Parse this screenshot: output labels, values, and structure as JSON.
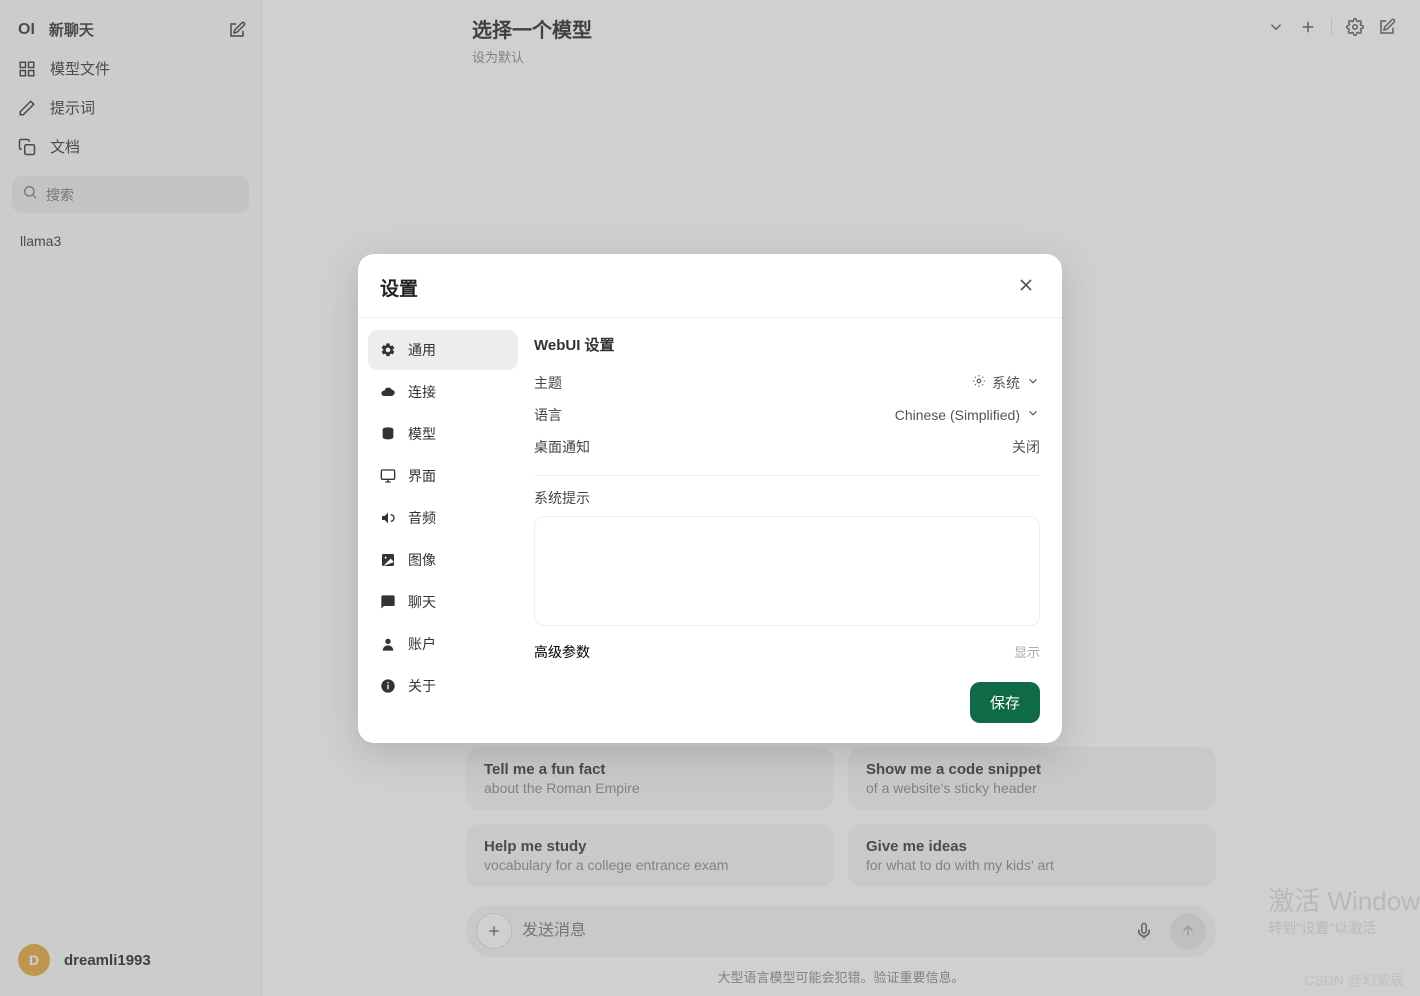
{
  "sidebar": {
    "logo_text": "OI",
    "new_chat": "新聊天",
    "items": [
      {
        "label": "模型文件"
      },
      {
        "label": "提示词"
      },
      {
        "label": "文档"
      }
    ],
    "search_placeholder": "搜索",
    "model_list": [
      {
        "name": "llama3"
      }
    ],
    "user": {
      "initial": "D",
      "name": "dreamli1993"
    }
  },
  "header": {
    "title": "选择一个模型",
    "subtitle": "设为默认"
  },
  "suggestions": [
    {
      "title": "Tell me a fun fact",
      "sub": "about the Roman Empire"
    },
    {
      "title": "Show me a code snippet",
      "sub": "of a website's sticky header"
    },
    {
      "title": "Help me study",
      "sub": "vocabulary for a college entrance exam"
    },
    {
      "title": "Give me ideas",
      "sub": "for what to do with my kids' art"
    }
  ],
  "composer": {
    "placeholder": "发送消息"
  },
  "disclaimer": "大型语言模型可能会犯错。验证重要信息。",
  "modal": {
    "title": "设置",
    "nav": [
      {
        "label": "通用"
      },
      {
        "label": "连接"
      },
      {
        "label": "模型"
      },
      {
        "label": "界面"
      },
      {
        "label": "音频"
      },
      {
        "label": "图像"
      },
      {
        "label": "聊天"
      },
      {
        "label": "账户"
      },
      {
        "label": "关于"
      }
    ],
    "section_title": "WebUI 设置",
    "theme_label": "主题",
    "theme_value": "系统",
    "language_label": "语言",
    "language_value": "Chinese (Simplified)",
    "notify_label": "桌面通知",
    "notify_value": "关闭",
    "sys_prompt_label": "系统提示",
    "advanced_label": "高级参数",
    "advanced_action": "显示",
    "save": "保存"
  },
  "watermark": {
    "line1": "激活 Window",
    "line2": "转到\"设置\"以激活 ",
    "csdn": "CSDN @幻紫辰"
  }
}
